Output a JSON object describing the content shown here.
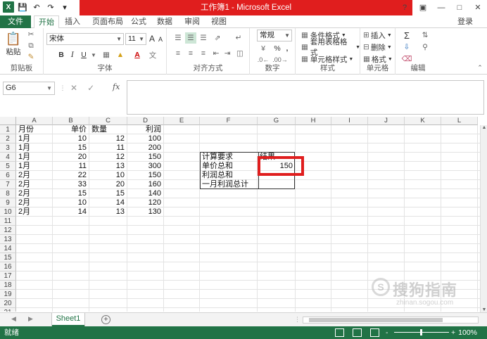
{
  "app": {
    "title": "工作簿1 - Microsoft Excel",
    "signin": "登录"
  },
  "tabs": [
    "文件",
    "开始",
    "插入",
    "页面布局",
    "公式",
    "数据",
    "审阅",
    "视图"
  ],
  "ribbon": {
    "clipboard": {
      "paste": "粘贴",
      "label": "剪贴板"
    },
    "font": {
      "name": "宋体",
      "size": "11",
      "bold": "B",
      "italic": "I",
      "underline": "U",
      "grow": "A",
      "shrink": "A",
      "label": "字体"
    },
    "alignment": {
      "label": "对齐方式"
    },
    "number": {
      "format": "常规",
      "percent": "%",
      "comma": ",",
      "label": "数字"
    },
    "styles": {
      "conditional": "条件格式",
      "table": "套用表格格式",
      "cell": "单元格样式",
      "label": "样式"
    },
    "cells": {
      "insert": "插入",
      "delete": "删除",
      "format": "格式",
      "label": "单元格"
    },
    "editing": {
      "sum": "Σ",
      "label": "编辑"
    }
  },
  "formula_bar": {
    "name_box": "G6",
    "cancel": "✕",
    "enter": "✓",
    "fx": "fx",
    "value": ""
  },
  "columns": [
    "A",
    "B",
    "C",
    "D",
    "E",
    "F",
    "G",
    "H",
    "I",
    "J",
    "K",
    "L"
  ],
  "rows": [
    "1",
    "2",
    "3",
    "4",
    "5",
    "6",
    "7",
    "8",
    "9",
    "10",
    "11",
    "12",
    "13",
    "14",
    "15",
    "16",
    "17",
    "18",
    "19",
    "20",
    "21"
  ],
  "cells": {
    "A": [
      "月份",
      "1月",
      "1月",
      "1月",
      "1月",
      "2月",
      "2月",
      "2月",
      "2月",
      "2月"
    ],
    "B": [
      "单价",
      "10",
      "15",
      "20",
      "11",
      "22",
      "33",
      "15",
      "10",
      "14"
    ],
    "C": [
      "数量",
      "12",
      "11",
      "12",
      "13",
      "10",
      "20",
      "15",
      "14",
      "13"
    ],
    "D": [
      "利润",
      "100",
      "200",
      "150",
      "300",
      "150",
      "160",
      "140",
      "120",
      "130"
    ],
    "F": [
      "计算要求",
      "单价总和",
      "利润总和",
      "一月利润总计"
    ],
    "G4": "结果",
    "G5": "150"
  },
  "sheets": [
    "Sheet1"
  ],
  "status": {
    "ready": "就绪",
    "zoom": "100%",
    "zoom_minus": "-",
    "zoom_plus": "+"
  },
  "watermark": {
    "brand": "搜狗指南",
    "url": "zhinan.sogou.com"
  }
}
